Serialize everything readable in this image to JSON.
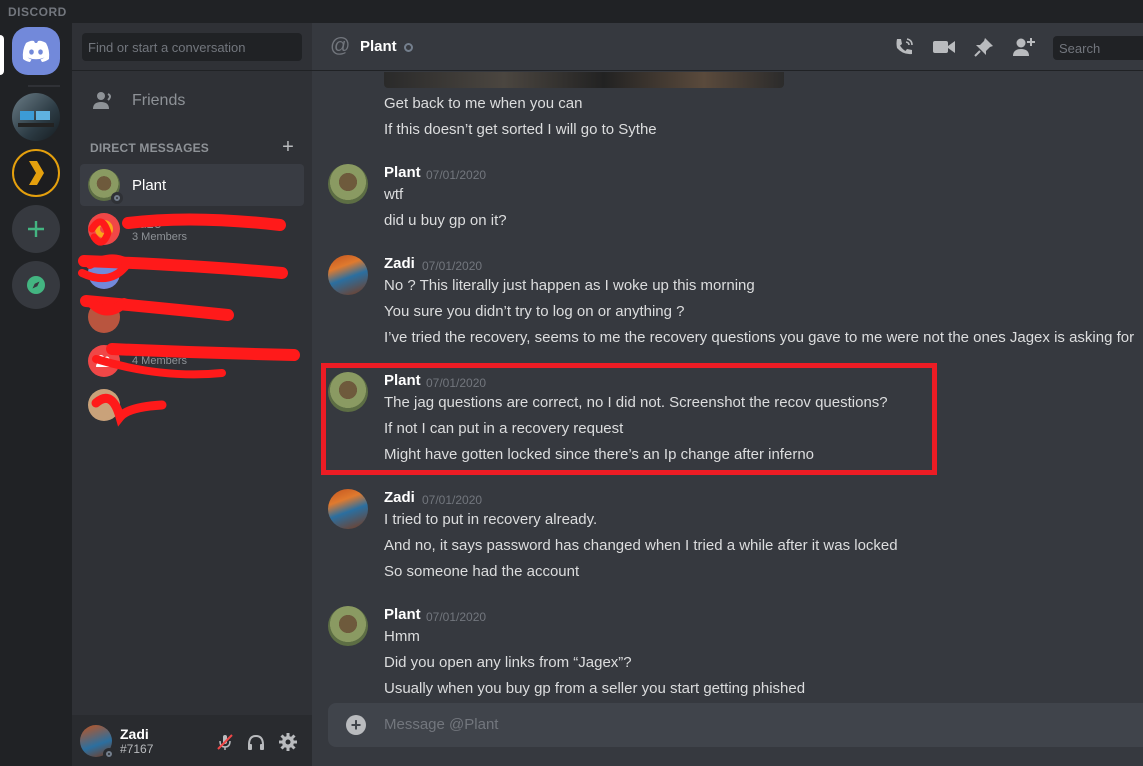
{
  "app": {
    "brand": "DISCORD"
  },
  "sidebar": {
    "search_placeholder": "Find or start a conversation",
    "friends_label": "Friends",
    "dm_header": "DIRECT MESSAGES",
    "dm_add": "+",
    "dms": [
      {
        "name": "Plant",
        "sub": "",
        "active": true
      },
      {
        "name": "suze",
        "sub": "3 Members",
        "active": false
      },
      {
        "name": "",
        "sub": "",
        "active": false
      },
      {
        "name": "",
        "sub": "",
        "active": false
      },
      {
        "name": "",
        "sub": "4 Members",
        "active": false
      },
      {
        "name": "",
        "sub": "",
        "active": false
      }
    ]
  },
  "user_panel": {
    "name": "Zadi",
    "tag": "#7167"
  },
  "chat": {
    "at": "@",
    "title": "Plant",
    "search_placeholder": "Search",
    "messages": [
      {
        "author": "",
        "time": "",
        "lines": [
          "Get back to me when you can",
          "If this doesn’t get sorted I will go to Sythe"
        ]
      },
      {
        "author": "Plant",
        "time": "07/01/2020",
        "lines": [
          "wtf",
          "did u buy gp on it?"
        ]
      },
      {
        "author": "Zadi",
        "time": "07/01/2020",
        "lines": [
          "No ? This literally just happen as I woke up this morning",
          "You sure you didn’t try to log on or anything ?",
          "I’ve tried the recovery, seems to me the recovery questions you gave to me were not the ones Jagex is asking for"
        ]
      },
      {
        "author": "Plant",
        "time": "07/01/2020",
        "lines": [
          "The jag questions are correct, no I did not. Screenshot the recov questions?",
          "If not I can put in a recovery request",
          "Might have gotten locked since there’s an Ip change after inferno"
        ]
      },
      {
        "author": "Zadi",
        "time": "07/01/2020",
        "lines": [
          "I tried to put in recovery already.",
          "And no, it says password has changed when I tried a while after it was locked",
          "So someone had the account"
        ]
      },
      {
        "author": "Plant",
        "time": "07/01/2020",
        "lines": [
          "Hmm",
          "Did you open any links from “Jagex”?",
          "Usually when you buy gp from a seller you start getting phished"
        ]
      }
    ],
    "composer_placeholder": "Message @Plant",
    "composer_plus": "+"
  },
  "colors": {
    "accent": "#7289da",
    "highlight": "#ed1c24",
    "scribble": "#ff1a1a"
  }
}
